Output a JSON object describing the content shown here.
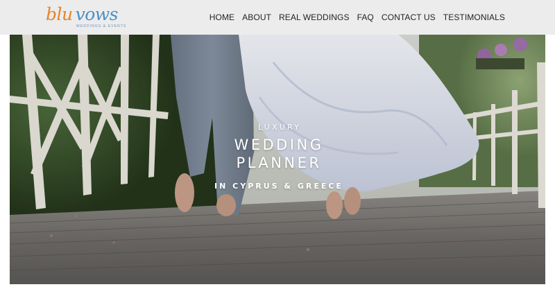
{
  "logo": {
    "part1": "blu",
    "part2": "vows",
    "tagline": "WEDDINGS & EVENTS"
  },
  "nav": {
    "items": [
      {
        "label": "HOME"
      },
      {
        "label": "ABOUT"
      },
      {
        "label": "REAL WEDDINGS"
      },
      {
        "label": "FAQ"
      },
      {
        "label": "CONTACT US"
      },
      {
        "label": "TESTIMONIALS"
      }
    ]
  },
  "hero": {
    "eyebrow": "LUXURY",
    "title_line1": "WEDDING",
    "title_line2": "PLANNER",
    "subtitle": "IN CYPRUS & GREECE"
  },
  "colors": {
    "header_bg": "#ececec",
    "logo_orange": "#e8832a",
    "logo_blue": "#4a90c8",
    "nav_text": "#222222"
  }
}
